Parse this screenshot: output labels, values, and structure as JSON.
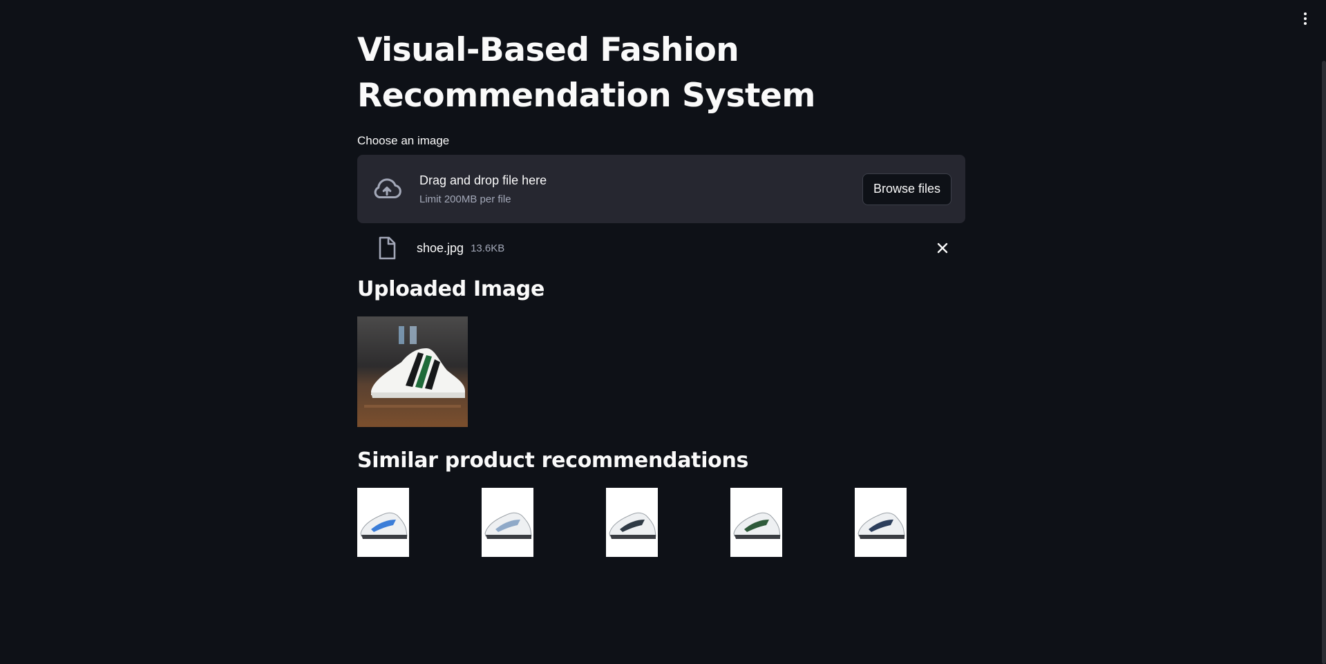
{
  "app": {
    "title": "Visual-Based Fashion Recommendation System",
    "menu_icon": "kebab-menu-icon"
  },
  "uploader": {
    "label": "Choose an image",
    "instruction": "Drag and drop file here",
    "limit": "Limit 200MB per file",
    "browse_label": "Browse files",
    "icon": "cloud-upload-icon"
  },
  "file": {
    "name": "shoe.jpg",
    "size": "13.6KB",
    "icon": "file-icon",
    "remove_icon": "close-icon"
  },
  "uploaded_section": {
    "heading": "Uploaded Image"
  },
  "recommendations": {
    "heading": "Similar product recommendations",
    "items": [
      {
        "accent": "#3b7dd8"
      },
      {
        "accent": "#8fa9c8"
      },
      {
        "accent": "#2f3a45"
      },
      {
        "accent": "#2e5a3a"
      },
      {
        "accent": "#2d3f5c"
      }
    ]
  },
  "colors": {
    "background": "#0e1117",
    "dropzone": "#262730",
    "text": "#fafafa",
    "muted": "#a3a8b8"
  }
}
